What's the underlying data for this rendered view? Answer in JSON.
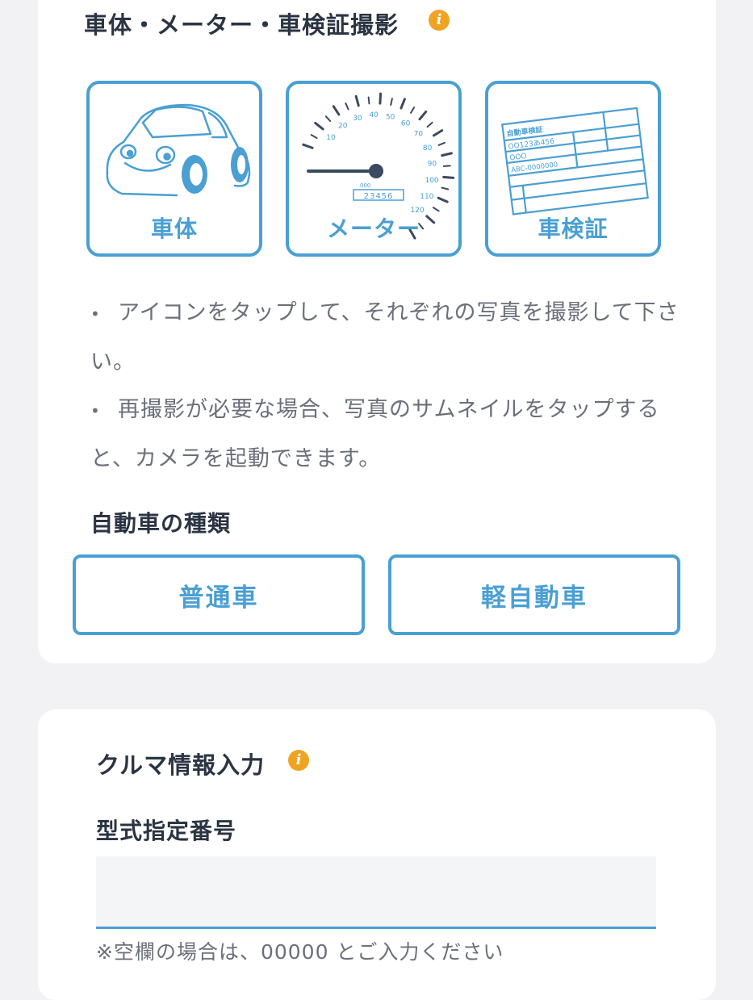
{
  "photo_section": {
    "title": "車体・メーター・車検証撮影",
    "info_icon": "info-icon",
    "tiles": [
      {
        "label": "車体",
        "icon": "car-icon"
      },
      {
        "label": "メーター",
        "icon": "speedometer-icon",
        "gauge_ticks": [
          "10",
          "20",
          "30",
          "40",
          "50",
          "60",
          "70",
          "80",
          "90",
          "100",
          "110",
          "120"
        ],
        "odometer_label": "000",
        "odometer": "23456"
      },
      {
        "label": "車検証",
        "icon": "vehicle-registration-icon",
        "doc_title": "自動車検証",
        "doc_lines": [
          "OO123あ456",
          "OOO",
          "ABC-0000000"
        ]
      }
    ],
    "notes": [
      {
        "bullet": "•",
        "text": "アイコンをタップして、それぞれの写真を撮影して下さい。"
      },
      {
        "bullet": "•",
        "text": "再撮影が必要な場合、写真のサムネイルをタップすると、カメラを起動できます。"
      }
    ],
    "car_type": {
      "title": "自動車の種類",
      "options": [
        "普通車",
        "軽自動車"
      ]
    }
  },
  "car_info_section": {
    "title": "クルマ情報入力",
    "info_icon": "info-icon",
    "model_number": {
      "label": "型式指定番号",
      "value": "",
      "placeholder": "",
      "hint": "※空欄の場合は、00000 とご入力ください"
    }
  },
  "colors": {
    "accent": "#4a9fd3",
    "info": "#f0a323",
    "background": "#f2f2f4",
    "card": "#ffffff"
  }
}
